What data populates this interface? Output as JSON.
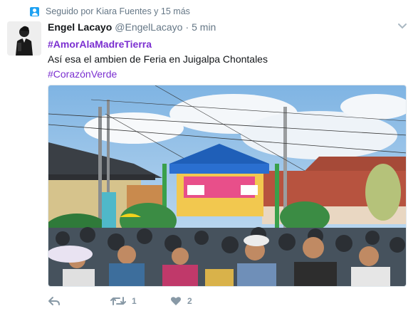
{
  "social_context": {
    "text": "Seguido por Kiara Fuentes y 15 más"
  },
  "tweet": {
    "display_name": "Engel Lacayo",
    "screen_name": "@EngelLacayo",
    "separator": "·",
    "timestamp": "5 min",
    "hashtag_1": "#AmorAlaMadreTierra",
    "text_line": "Así esa el ambien de Feria en Juigalpa Chontales",
    "hashtag_2": "#CorazónVerde"
  },
  "actions": {
    "reply_icon": "reply-icon",
    "retweet_icon": "retweet-icon",
    "retweet_count": "1",
    "like_icon": "heart-icon",
    "like_count": "2"
  },
  "colors": {
    "hashtag": "#7b2fd0",
    "muted": "#657786",
    "action": "#8899a6",
    "accent": "#1da1f2"
  }
}
